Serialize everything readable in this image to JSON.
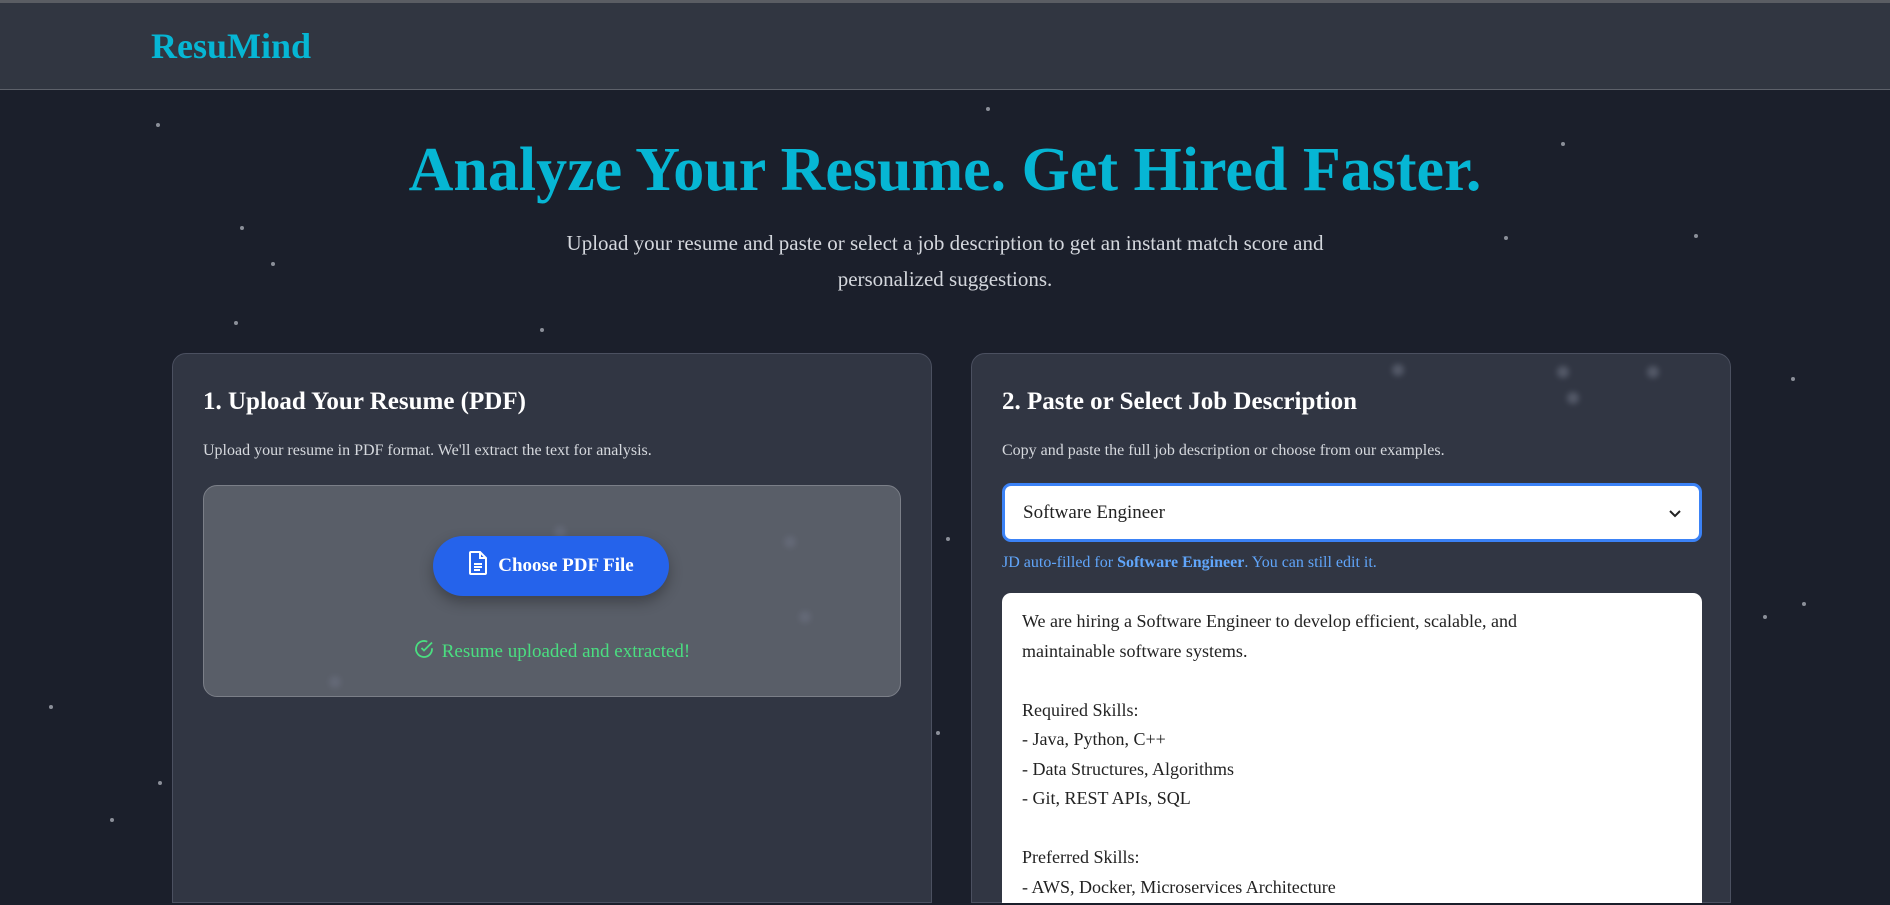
{
  "header": {
    "logo": "ResuMind"
  },
  "hero": {
    "title": "Analyze Your Resume. Get Hired Faster.",
    "subtitle": "Upload your resume and paste or select a job description to get an instant match score and personalized suggestions."
  },
  "upload_card": {
    "title": "1. Upload Your Resume (PDF)",
    "description": "Upload your resume in PDF format. We'll extract the text for analysis.",
    "button_label": "Choose PDF File",
    "button_icon": "file-icon",
    "status": "Resume uploaded and extracted!",
    "status_icon": "check-circle-icon"
  },
  "jd_card": {
    "title": "2. Paste or Select Job Description",
    "description": "Copy and paste the full job description or choose from our examples.",
    "selected_role": "Software Engineer",
    "hint_prefix": "JD auto-filled for ",
    "hint_role": "Software Engineer",
    "hint_suffix": ". You can still edit it.",
    "jd_text": "We are hiring a Software Engineer to develop efficient, scalable, and\nmaintainable software systems.\n\nRequired Skills:\n- Java, Python, C++\n- Data Structures, Algorithms\n- Git, REST APIs, SQL\n\nPreferred Skills:\n- AWS, Docker, Microservices Architecture"
  },
  "colors": {
    "accent": "#06b6d4",
    "button": "#2563eb",
    "success": "#4ade80",
    "link": "#60a5fa"
  }
}
